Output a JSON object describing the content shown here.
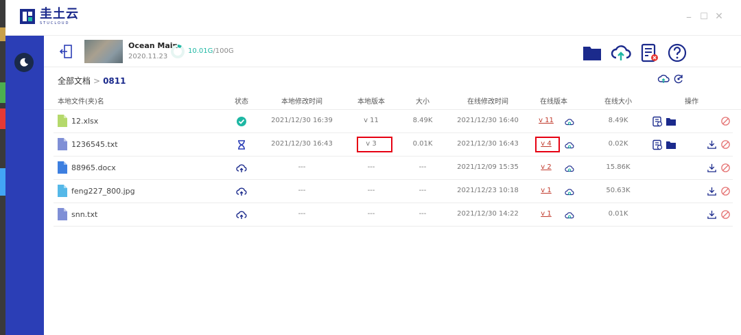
{
  "app": {
    "name": "圭土云",
    "tagline": "STUCLOUD"
  },
  "window_controls": {
    "minimize": "–",
    "maximize": "☐",
    "close": "✕"
  },
  "workspace": {
    "name": "Ocean Main",
    "date": "2020.11.23",
    "used": "10.01G",
    "total": "/100G",
    "used_fraction": 0.1001
  },
  "breadcrumb": {
    "root": "全部文档",
    "separator": ">",
    "current": "0811"
  },
  "table": {
    "headers": {
      "name": "本地文件(夹)名",
      "status": "状态",
      "local_modified": "本地修改时间",
      "local_version": "本地版本",
      "size": "大小",
      "online_modified": "在线修改时间",
      "online_version": "在线版本",
      "online_size": "在线大小",
      "actions": "操作"
    },
    "rows": [
      {
        "name": "12.xlsx",
        "type": "xlsx",
        "status": "synced",
        "local_modified": "2021/12/30 16:39",
        "local_version": "v 11",
        "size": "8.49K",
        "online_modified": "2021/12/30 16:40",
        "online_version": "v 11",
        "online_size": "8.49K"
      },
      {
        "name": "1236545.txt",
        "type": "txt",
        "status": "pending",
        "local_modified": "2021/12/30 16:43",
        "local_version": "v 3",
        "size": "0.01K",
        "online_modified": "2021/12/30 16:43",
        "online_version": "v 4",
        "online_size": "0.02K"
      },
      {
        "name": "88965.docx",
        "type": "docx",
        "status": "cloud",
        "local_modified": "---",
        "local_version": "---",
        "size": "---",
        "online_modified": "2021/12/09 15:35",
        "online_version": "v 2",
        "online_size": "15.86K"
      },
      {
        "name": "feng227_800.jpg",
        "type": "jpg",
        "status": "cloud",
        "local_modified": "---",
        "local_version": "---",
        "size": "---",
        "online_modified": "2021/12/23 10:18",
        "online_version": "v 1",
        "online_size": "50.63K"
      },
      {
        "name": "snn.txt",
        "type": "txt",
        "status": "cloud",
        "local_modified": "---",
        "local_version": "---",
        "size": "---",
        "online_modified": "2021/12/30 14:22",
        "online_version": "v 1",
        "online_size": "0.01K"
      }
    ]
  },
  "colors": {
    "sidebar": "#2b3eb6",
    "brand": "#1b2a8c",
    "accent": "#1db7a3",
    "danger": "#e60012"
  }
}
